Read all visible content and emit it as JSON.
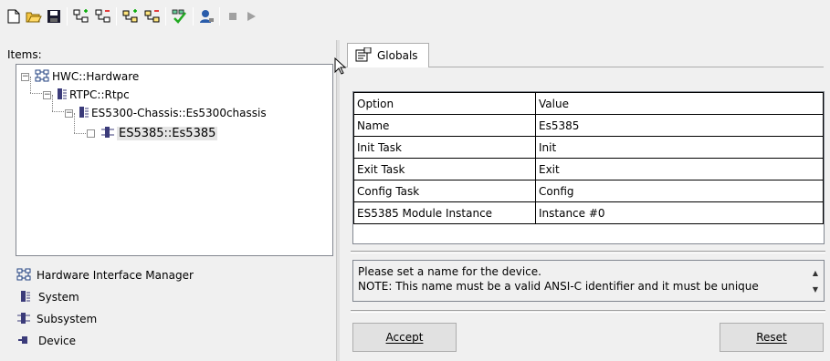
{
  "toolbar": {
    "buttons": [
      {
        "name": "new-icon"
      },
      {
        "name": "open-folder-icon"
      },
      {
        "name": "save-icon"
      },
      {
        "name": "add-system-icon"
      },
      {
        "name": "remove-system-icon"
      },
      {
        "name": "add-subsystem-icon"
      },
      {
        "name": "remove-subsystem-icon"
      },
      {
        "name": "check-icon"
      },
      {
        "name": "user-config-icon"
      },
      {
        "name": "stop-icon"
      },
      {
        "name": "run-icon"
      }
    ]
  },
  "left": {
    "items_label": "Items:",
    "tree": [
      {
        "label": "HWC::Hardware",
        "level": 0,
        "expander": "−",
        "icon": "hardware-icon"
      },
      {
        "label": "RTPC::Rtpc",
        "level": 1,
        "expander": "−",
        "icon": "system-icon"
      },
      {
        "label": "ES5300-Chassis::Es5300chassis",
        "level": 2,
        "expander": "−",
        "icon": "system-icon"
      },
      {
        "label": "ES5385::Es5385",
        "level": 3,
        "expander": "",
        "icon": "subsystem-icon",
        "selected": true
      }
    ],
    "legend": [
      {
        "label": "Hardware Interface Manager",
        "icon": "hardware-icon"
      },
      {
        "label": "System",
        "icon": "system-icon"
      },
      {
        "label": "Subsystem",
        "icon": "subsystem-icon"
      },
      {
        "label": "Device",
        "icon": "device-icon"
      }
    ]
  },
  "right": {
    "tab_label": "Globals",
    "grid": {
      "headers": [
        "Option",
        "Value"
      ],
      "rows": [
        [
          "Name",
          "Es5385"
        ],
        [
          "Init Task",
          "Init"
        ],
        [
          "Exit Task",
          "Exit"
        ],
        [
          "Config Task",
          "Config"
        ],
        [
          "ES5385 Module Instance",
          "Instance #0"
        ]
      ]
    },
    "description": {
      "line1": "Please set a name for the device.",
      "line2": "NOTE: This name must be a valid ANSI-C identifier and it must be unique"
    },
    "accept_label": "Accept",
    "reset_label": "Reset"
  }
}
